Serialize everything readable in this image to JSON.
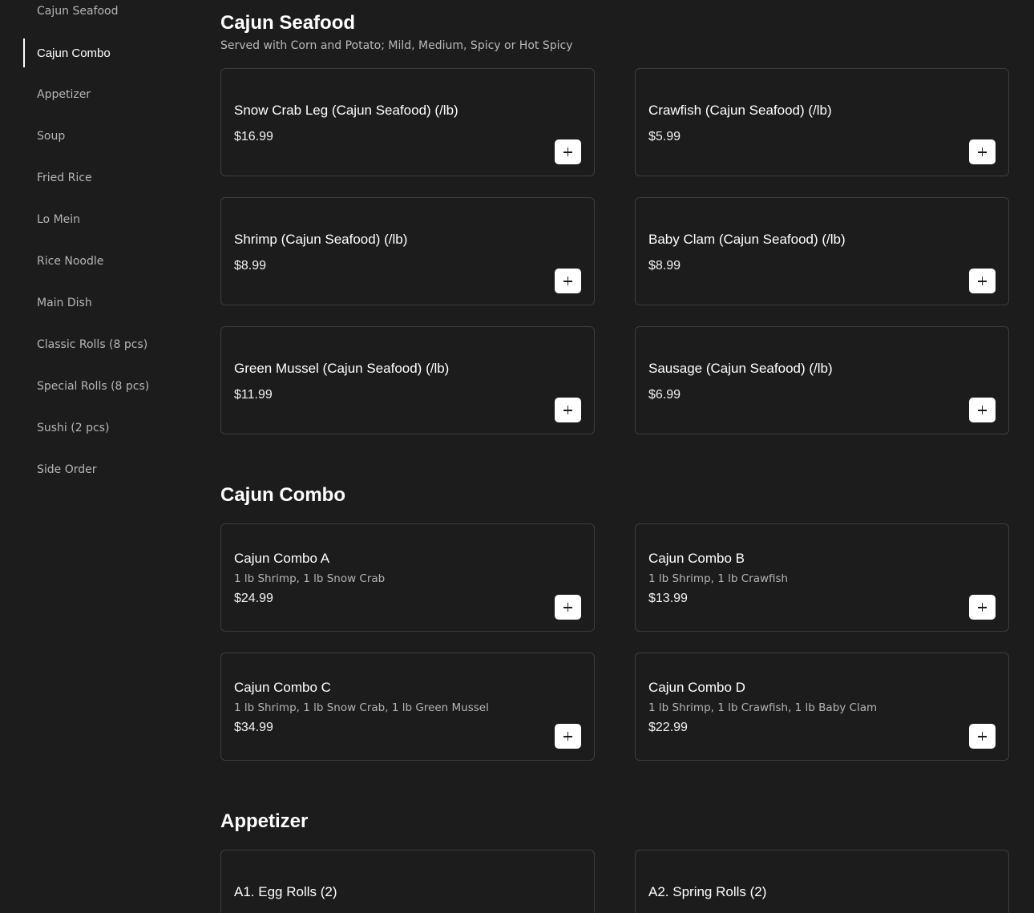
{
  "sidebar": {
    "items": [
      {
        "label": "Cajun Seafood",
        "active": false
      },
      {
        "label": "Cajun Combo",
        "active": true
      },
      {
        "label": "Appetizer",
        "active": false
      },
      {
        "label": "Soup",
        "active": false
      },
      {
        "label": "Fried Rice",
        "active": false
      },
      {
        "label": "Lo Mein",
        "active": false
      },
      {
        "label": "Rice Noodle",
        "active": false
      },
      {
        "label": "Main Dish",
        "active": false
      },
      {
        "label": "Classic Rolls (8 pcs)",
        "active": false
      },
      {
        "label": "Special Rolls (8 pcs)",
        "active": false
      },
      {
        "label": "Sushi (2 pcs)",
        "active": false
      },
      {
        "label": "Side Order",
        "active": false
      }
    ]
  },
  "sections": [
    {
      "title": "Cajun Seafood",
      "subtitle": "Served with Corn and Potato; Mild, Medium, Spicy or Hot Spicy",
      "items": [
        {
          "name": "Snow Crab Leg (Cajun Seafood) (/lb)",
          "description": "",
          "price": "$16.99"
        },
        {
          "name": "Crawfish (Cajun Seafood) (/lb)",
          "description": "",
          "price": "$5.99"
        },
        {
          "name": "Shrimp (Cajun Seafood) (/lb)",
          "description": "",
          "price": "$8.99"
        },
        {
          "name": "Baby Clam (Cajun Seafood) (/lb)",
          "description": "",
          "price": "$8.99"
        },
        {
          "name": "Green Mussel (Cajun Seafood) (/lb)",
          "description": "",
          "price": "$11.99"
        },
        {
          "name": "Sausage (Cajun Seafood) (/lb)",
          "description": "",
          "price": "$6.99"
        }
      ]
    },
    {
      "title": "Cajun Combo",
      "subtitle": "",
      "items": [
        {
          "name": "Cajun Combo A",
          "description": "1 lb Shrimp, 1 lb Snow Crab",
          "price": "$24.99"
        },
        {
          "name": "Cajun Combo B",
          "description": "1 lb Shrimp, 1 lb Crawfish",
          "price": "$13.99"
        },
        {
          "name": "Cajun Combo C",
          "description": "1 lb Shrimp, 1 lb Snow Crab, 1 lb Green Mussel",
          "price": "$34.99"
        },
        {
          "name": "Cajun Combo D",
          "description": "1 lb Shrimp, 1 lb Crawfish, 1 lb Baby Clam",
          "price": "$22.99"
        }
      ]
    },
    {
      "title": "Appetizer",
      "subtitle": "",
      "items": [
        {
          "name": "A1. Egg Rolls (2)",
          "description": "",
          "price": ""
        },
        {
          "name": "A2. Spring Rolls (2)",
          "description": "",
          "price": ""
        }
      ]
    }
  ],
  "icons": {
    "add": "plus-icon"
  },
  "colors": {
    "background": "#1c1c1d",
    "card_border": "#3d3d3f",
    "text_primary": "#ffffff",
    "text_secondary": "#b6b6b6",
    "button_bg": "#ffffff"
  }
}
